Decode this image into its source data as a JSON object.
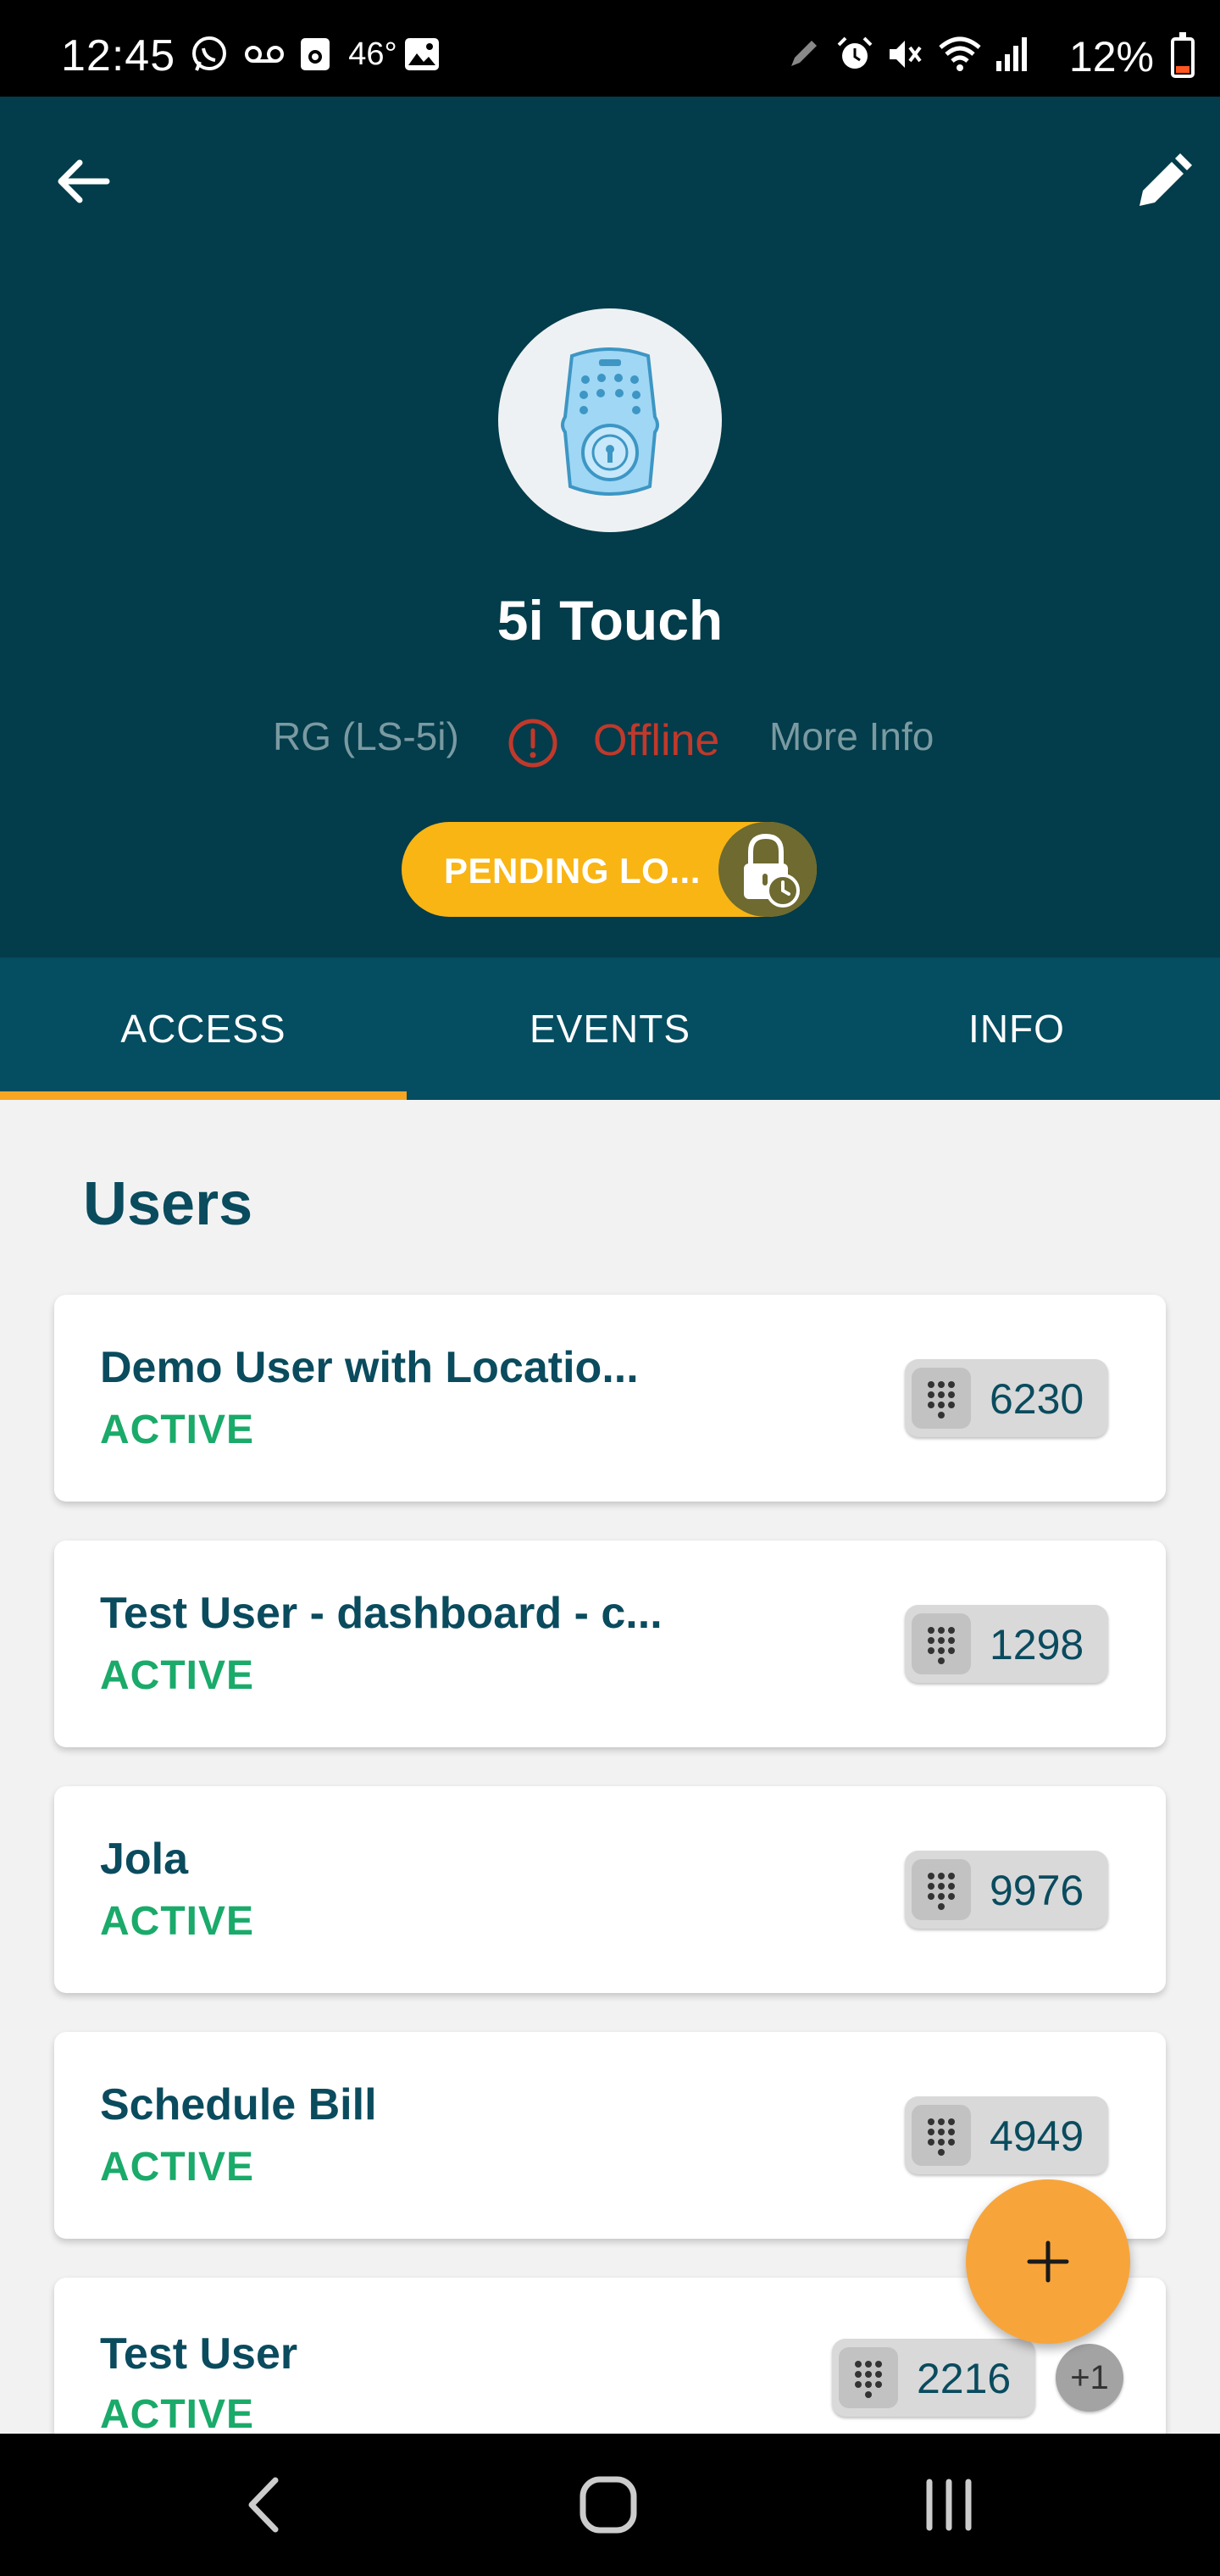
{
  "status_bar": {
    "time": "12:45",
    "temperature": "46°",
    "battery": "12%",
    "icons": [
      "whatsapp-icon",
      "voicemail-icon",
      "camera-app-icon",
      "gallery-icon",
      "pen-icon",
      "alarm-icon",
      "mute-icon",
      "wifi-icon",
      "signal-icon",
      "battery-icon"
    ]
  },
  "header": {
    "device_name": "5i Touch",
    "model": "RG (LS-5i)",
    "connection_status": "Offline",
    "more_info": "More Info",
    "pending_label": "PENDING LO...",
    "colors": {
      "background": "#033c4a",
      "pending": "#f9b513",
      "offline": "#c0392b"
    }
  },
  "tabs": [
    {
      "label": "ACCESS",
      "active": true
    },
    {
      "label": "EVENTS",
      "active": false
    },
    {
      "label": "INFO",
      "active": false
    }
  ],
  "users_section": {
    "title": "Users",
    "users": [
      {
        "name": "Demo User with Locatio...",
        "status": "ACTIVE",
        "code": "6230"
      },
      {
        "name": " Test User - dashboard - c...",
        "status": "ACTIVE",
        "code": "1298"
      },
      {
        "name": "Jola",
        "status": "ACTIVE",
        "code": "9976"
      },
      {
        "name": "Schedule Bill",
        "status": "ACTIVE",
        "code": "4949"
      },
      {
        "name": "Test User",
        "status": "ACTIVE",
        "code": "2216",
        "extra": "+1"
      }
    ]
  },
  "fab": {
    "icon": "plus-icon"
  },
  "nav_bar": {
    "icons": [
      "nav-back-icon",
      "nav-home-icon",
      "nav-recents-icon"
    ]
  }
}
